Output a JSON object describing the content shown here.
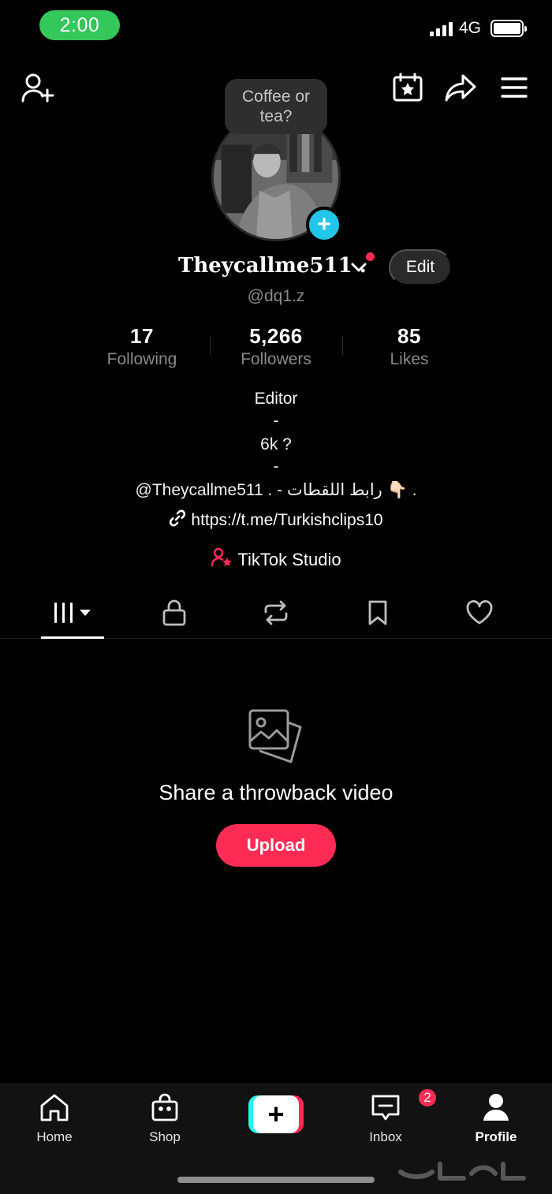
{
  "status_bar": {
    "time": "2:00",
    "network": "4G",
    "battery_level": 1.0
  },
  "header": {
    "add_friend_icon": "person-plus-icon",
    "calendar_icon": "calendar-star-icon",
    "share_icon": "share-arrow-icon",
    "menu_icon": "hamburger-menu-icon"
  },
  "profile": {
    "note_bubble": "Coffee or tea?",
    "display_name": "Theycallme511 .",
    "edit_label": "Edit",
    "handle": "@dq1.z",
    "stats": [
      {
        "value": "17",
        "label": "Following"
      },
      {
        "value": "5,266",
        "label": "Followers"
      },
      {
        "value": "85",
        "label": "Likes"
      }
    ],
    "bio": [
      "Editor",
      "-",
      "6k ?",
      "-",
      "@Theycallme511 . - رابط اللقطات 👇🏻 ."
    ],
    "link": "https://t.me/Turkishclips10",
    "studio_label": "TikTok Studio"
  },
  "tabs": [
    {
      "icon": "videos-grid-icon",
      "active": true
    },
    {
      "icon": "lock-icon",
      "active": false
    },
    {
      "icon": "repost-icon",
      "active": false
    },
    {
      "icon": "bookmark-icon",
      "active": false
    },
    {
      "icon": "heart-icon",
      "active": false
    }
  ],
  "empty_state": {
    "icon": "photos-icon",
    "title": "Share a throwback video",
    "button_label": "Upload"
  },
  "bottom_nav": {
    "items": [
      {
        "label": "Home",
        "icon": "home-icon"
      },
      {
        "label": "Shop",
        "icon": "shop-bag-icon"
      },
      {
        "label": "",
        "icon": "create-plus-icon"
      },
      {
        "label": "Inbox",
        "icon": "inbox-icon",
        "badge": "2"
      },
      {
        "label": "Profile",
        "icon": "profile-icon",
        "active": true
      }
    ]
  },
  "colors": {
    "accent": "#fe2c55",
    "cyan": "#25f4ee",
    "status_green": "#34c759",
    "avatar_plus": "#22c6e9"
  }
}
